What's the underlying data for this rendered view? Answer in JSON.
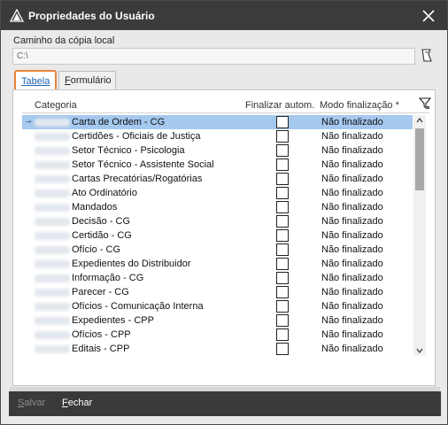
{
  "window": {
    "title": "Propriedades do Usuário"
  },
  "local_copy": {
    "label": "Caminho da cópia local",
    "value": "C:\\"
  },
  "tabs": [
    {
      "label_first": "T",
      "label_rest": "abela",
      "active": true
    },
    {
      "label_first": "F",
      "label_rest": "ormulário",
      "active": false
    }
  ],
  "grid": {
    "headers": {
      "categoria": "Categoria",
      "finalizar": "Finalizar autom.",
      "modo": "Modo finalização *"
    },
    "rows": [
      {
        "categoria": "Carta de Ordem - CG",
        "auto_finalize": false,
        "modo": "Não finalizado",
        "selected": true,
        "indicator": "→"
      },
      {
        "categoria": "Certidões - Oficiais de Justiça",
        "auto_finalize": false,
        "modo": "Não finalizado",
        "selected": false,
        "indicator": ""
      },
      {
        "categoria": "Setor Técnico - Psicologia",
        "auto_finalize": false,
        "modo": "Não finalizado",
        "selected": false,
        "indicator": ""
      },
      {
        "categoria": "Setor Técnico - Assistente Social",
        "auto_finalize": false,
        "modo": "Não finalizado",
        "selected": false,
        "indicator": ""
      },
      {
        "categoria": "Cartas Precatórias/Rogatórias",
        "auto_finalize": false,
        "modo": "Não finalizado",
        "selected": false,
        "indicator": ""
      },
      {
        "categoria": "Ato Ordinatório",
        "auto_finalize": false,
        "modo": "Não finalizado",
        "selected": false,
        "indicator": ""
      },
      {
        "categoria": "Mandados",
        "auto_finalize": false,
        "modo": "Não finalizado",
        "selected": false,
        "indicator": ""
      },
      {
        "categoria": "Decisão - CG",
        "auto_finalize": false,
        "modo": "Não finalizado",
        "selected": false,
        "indicator": ""
      },
      {
        "categoria": "Certidão - CG",
        "auto_finalize": false,
        "modo": "Não finalizado",
        "selected": false,
        "indicator": ""
      },
      {
        "categoria": "Ofício - CG",
        "auto_finalize": false,
        "modo": "Não finalizado",
        "selected": false,
        "indicator": ""
      },
      {
        "categoria": "Expedientes do Distribuidor",
        "auto_finalize": false,
        "modo": "Não finalizado",
        "selected": false,
        "indicator": ""
      },
      {
        "categoria": "Informação - CG",
        "auto_finalize": false,
        "modo": "Não finalizado",
        "selected": false,
        "indicator": ""
      },
      {
        "categoria": "Parecer - CG",
        "auto_finalize": false,
        "modo": "Não finalizado",
        "selected": false,
        "indicator": ""
      },
      {
        "categoria": "Ofícios - Comunicação Interna",
        "auto_finalize": false,
        "modo": "Não finalizado",
        "selected": false,
        "indicator": ""
      },
      {
        "categoria": "Expedientes - CPP",
        "auto_finalize": false,
        "modo": "Não finalizado",
        "selected": false,
        "indicator": ""
      },
      {
        "categoria": "Ofícios - CPP",
        "auto_finalize": false,
        "modo": "Não finalizado",
        "selected": false,
        "indicator": ""
      },
      {
        "categoria": "Editais - CPP",
        "auto_finalize": false,
        "modo": "Não finalizado",
        "selected": false,
        "indicator": ""
      }
    ]
  },
  "footer": {
    "salvar_first": "S",
    "salvar_rest": "alvar",
    "fechar_first": "F",
    "fechar_rest": "echar"
  },
  "colors": {
    "titlebar": "#3b3b3b",
    "selection": "#a5c8ef",
    "active_tab_border": "#e8853a",
    "active_tab_text": "#1e64b4"
  },
  "icons": {
    "app": "app-logo-icon",
    "close": "close-icon",
    "browse": "folder-browse-icon",
    "filter": "filter-icon",
    "row_indicator": "arrow-right-icon"
  }
}
